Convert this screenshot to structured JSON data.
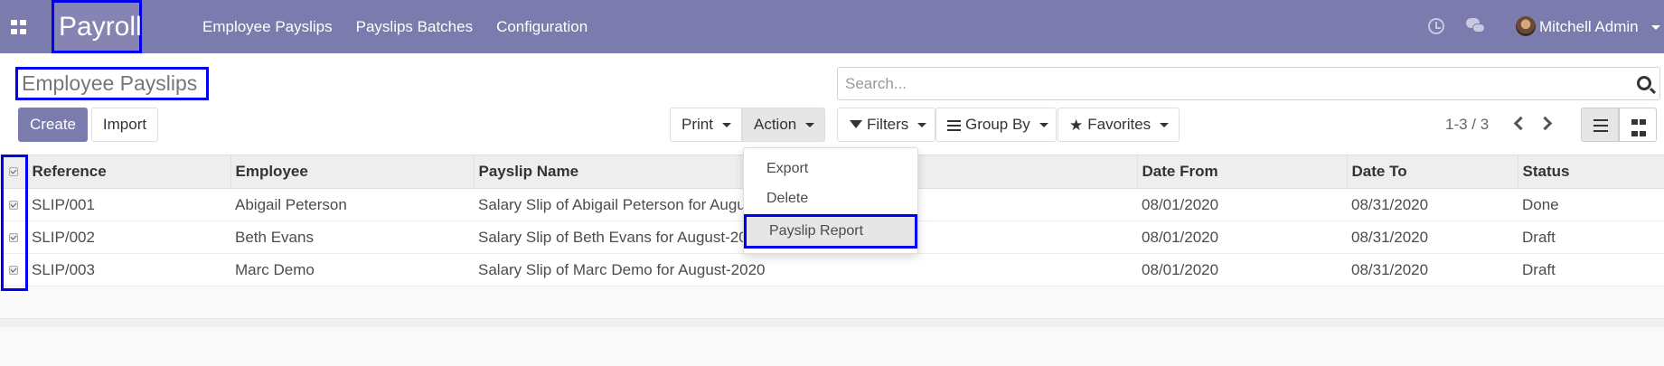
{
  "topbar": {
    "app_name": "Payroll",
    "menu": [
      "Employee Payslips",
      "Payslips Batches",
      "Configuration"
    ],
    "user": "Mitchell Admin"
  },
  "control_panel": {
    "title": "Employee Payslips",
    "search_placeholder": "Search...",
    "create_label": "Create",
    "import_label": "Import",
    "print_label": "Print",
    "action_label": "Action",
    "filters_label": "Filters",
    "groupby_label": "Group By",
    "favorites_label": "Favorites",
    "pager": "1-3 / 3"
  },
  "action_menu": {
    "items": [
      "Export",
      "Delete",
      "Payslip Report"
    ]
  },
  "table": {
    "columns": [
      "Reference",
      "Employee",
      "Payslip Name",
      "Date From",
      "Date To",
      "Status"
    ],
    "rows": [
      [
        "SLIP/001",
        "Abigail Peterson",
        "Salary Slip of Abigail Peterson for August-2020",
        "08/01/2020",
        "08/31/2020",
        "Done"
      ],
      [
        "SLIP/002",
        "Beth Evans",
        "Salary Slip of Beth Evans for August-2020",
        "08/01/2020",
        "08/31/2020",
        "Draft"
      ],
      [
        "SLIP/003",
        "Marc Demo",
        "Salary Slip of Marc Demo for August-2020",
        "08/01/2020",
        "08/31/2020",
        "Draft"
      ]
    ]
  },
  "colors": {
    "brand": "#7c7bad",
    "highlight": "#0000ee"
  }
}
